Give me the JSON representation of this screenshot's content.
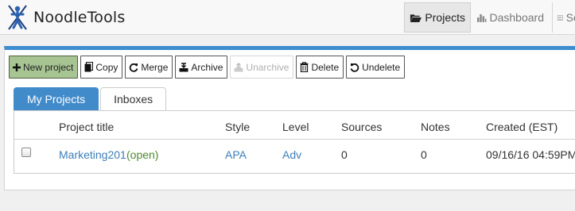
{
  "brand": {
    "name": "NoodleTools"
  },
  "nav": {
    "projects": "Projects",
    "dashboard": "Dashboard",
    "partial_next": "Sc"
  },
  "toolbar": {
    "new_project": "New project",
    "copy": "Copy",
    "merge": "Merge",
    "archive": "Archive",
    "unarchive": "Unarchive",
    "delete": "Delete",
    "undelete": "Undelete"
  },
  "tabs": [
    {
      "label": "My Projects",
      "active": true
    },
    {
      "label": "Inboxes",
      "active": false
    }
  ],
  "table": {
    "columns": [
      "Project title",
      "Style",
      "Level",
      "Sources",
      "Notes",
      "Created (EST)"
    ],
    "rows": [
      {
        "title": "Marketing201",
        "status": "(open)",
        "style": "APA",
        "level": "Adv",
        "sources": "0",
        "notes": "0",
        "created": "09/16/16 04:59PM"
      }
    ]
  },
  "colors": {
    "accent": "#3e8dcf",
    "primary_button": "#a7c493",
    "link": "#3d7db8",
    "status_open": "#4b8a2f"
  }
}
